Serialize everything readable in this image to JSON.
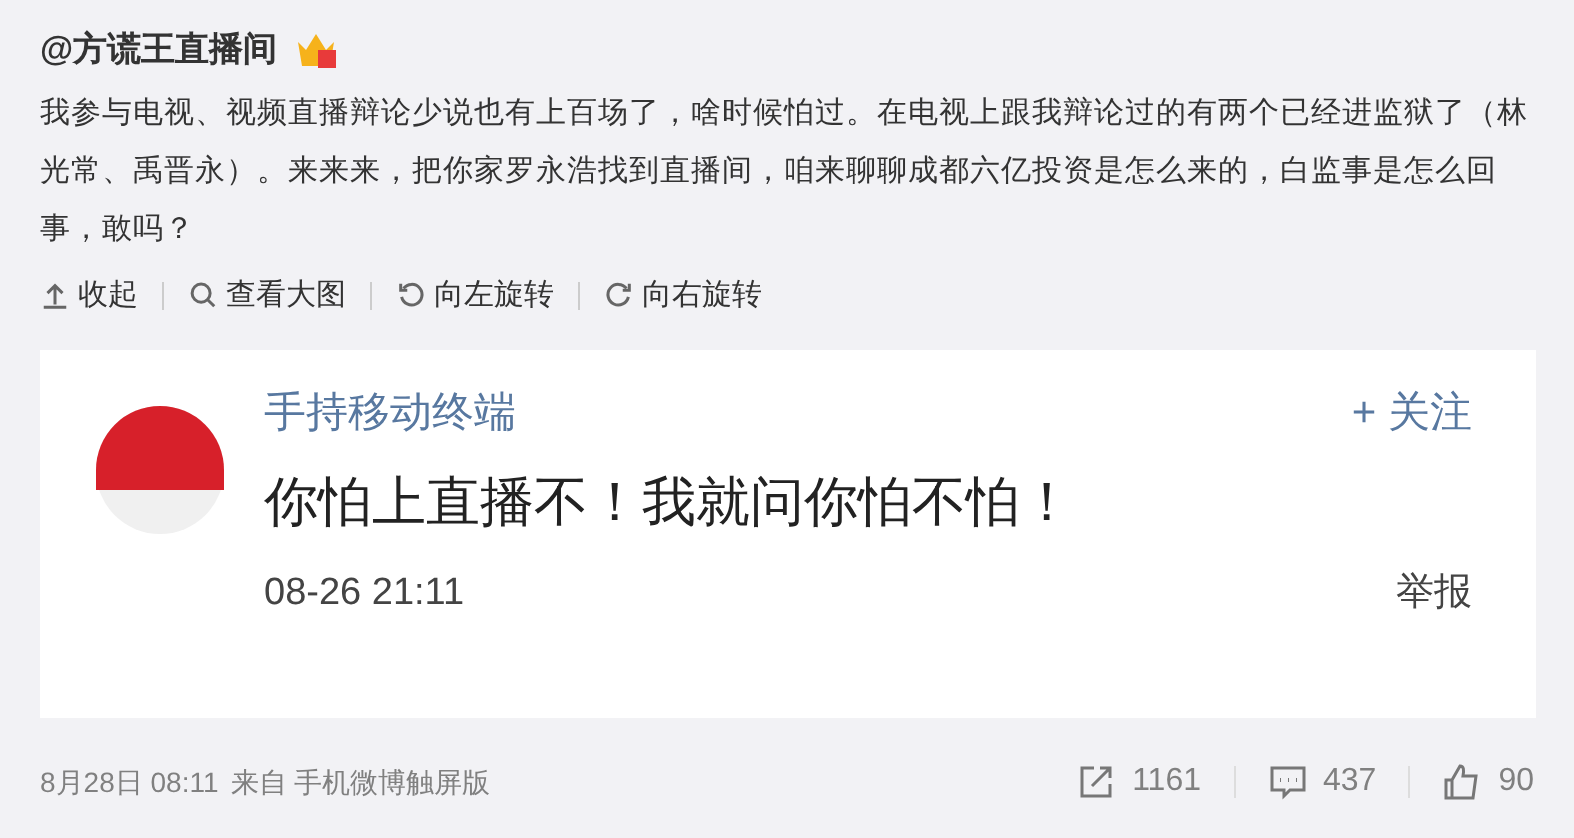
{
  "post": {
    "author": "@方谎王直播间",
    "text": "我参与电视、视频直播辩论少说也有上百场了，啥时候怕过。在电视上跟我辩论过的有两个已经进监狱了（林光常、禹晋永）。来来来，把你家罗永浩找到直播间，咱来聊聊成都六亿投资是怎么来的，白监事是怎么回事，敢吗？"
  },
  "image_actions": [
    {
      "kind": "collapse",
      "label": "收起"
    },
    {
      "kind": "zoom",
      "label": "查看大图"
    },
    {
      "kind": "rotate_left",
      "label": "向左旋转"
    },
    {
      "kind": "rotate_right",
      "label": "向右旋转"
    }
  ],
  "embedded": {
    "author": "手持移动终端",
    "follow": "+ 关注",
    "text": "你怕上直播不！我就问你怕不怕！",
    "time": "08-26 21:11",
    "report": "举报"
  },
  "footer": {
    "time": "8月28日 08:11",
    "source": "来自 手机微博触屏版",
    "stats": [
      {
        "kind": "repost",
        "count": "1161"
      },
      {
        "kind": "comment",
        "count": "437"
      },
      {
        "kind": "like",
        "count": "90"
      }
    ]
  }
}
